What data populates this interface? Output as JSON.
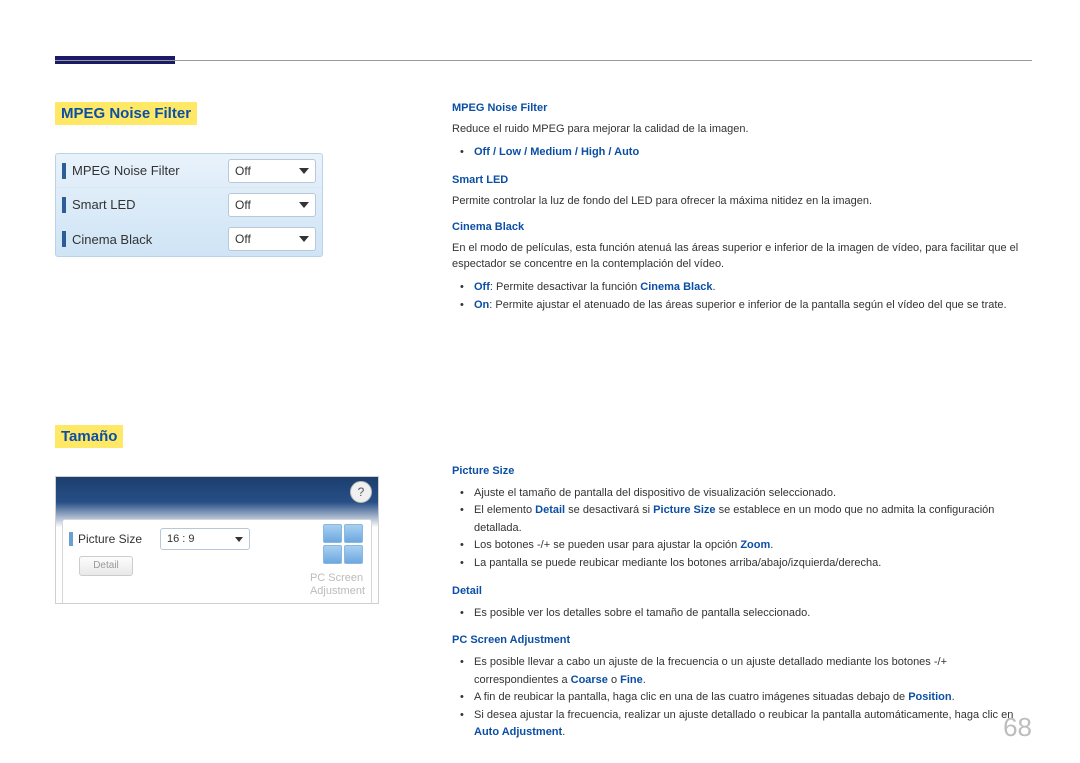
{
  "page_number": "68",
  "left": {
    "section1_title": "MPEG Noise Filter",
    "panel1": {
      "rows": [
        {
          "label": "MPEG Noise Filter",
          "value": "Off"
        },
        {
          "label": "Smart LED",
          "value": "Off"
        },
        {
          "label": "Cinema Black",
          "value": "Off"
        }
      ]
    },
    "section2_title": "Tamaño",
    "panel2": {
      "help": "?",
      "picture_size_label": "Picture Size",
      "picture_size_value": "16 : 9",
      "detail_btn": "Detail",
      "pc_adjust": "PC Screen\nAdjustment"
    }
  },
  "right": {
    "mpeg": {
      "heading": "MPEG Noise Filter",
      "desc": "Reduce el ruido MPEG para mejorar la calidad de la imagen.",
      "options_prefix": "",
      "options": "Off / Low / Medium / High / Auto"
    },
    "smartled": {
      "heading": "Smart LED",
      "desc": "Permite controlar la luz de fondo del LED para ofrecer la máxima nitidez en la imagen."
    },
    "cinema": {
      "heading": "Cinema Black",
      "desc": "En el modo de películas, esta función atenuá las áreas superior e inferior de la imagen de vídeo, para facilitar que el espectador se concentre en la contemplación del vídeo.",
      "off_label": "Off",
      "off_text": ": Permite desactivar la función ",
      "off_feature": "Cinema Black",
      "on_label": "On",
      "on_text": ": Permite ajustar el atenuado de las áreas superior e inferior de la pantalla según el vídeo del que se trate."
    },
    "picsize": {
      "heading": "Picture Size",
      "b1": "Ajuste el tamaño de pantalla del dispositivo de visualización seleccionado.",
      "b2_pre": "El elemento ",
      "b2_detail": "Detail",
      "b2_mid": " se desactivará si ",
      "b2_ps": "Picture Size",
      "b2_post": " se establece en un modo que no admita la configuración detallada.",
      "b3_pre": "Los botones -/+ se pueden usar para ajustar la opción ",
      "b3_zoom": "Zoom",
      "b4": "La pantalla se puede reubicar mediante los botones arriba/abajo/izquierda/derecha."
    },
    "detail": {
      "heading": "Detail",
      "b1": "Es posible ver los detalles sobre el tamaño de pantalla seleccionado."
    },
    "pcadj": {
      "heading": "PC Screen Adjustment",
      "b1_pre": "Es posible llevar a cabo un ajuste de la frecuencia o un ajuste detallado mediante los botones -/+ correspondientes a ",
      "b1_coarse": "Coarse",
      "b1_or": " o ",
      "b1_fine": "Fine",
      "b2_pre": "A fin de reubicar la pantalla, haga clic en una de las cuatro imágenes situadas debajo de ",
      "b2_position": "Position",
      "b3_pre": "Si desea ajustar la frecuencia, realizar un ajuste detallado o reubicar la pantalla automáticamente, haga clic en ",
      "b3_auto": "Auto Adjustment"
    }
  }
}
